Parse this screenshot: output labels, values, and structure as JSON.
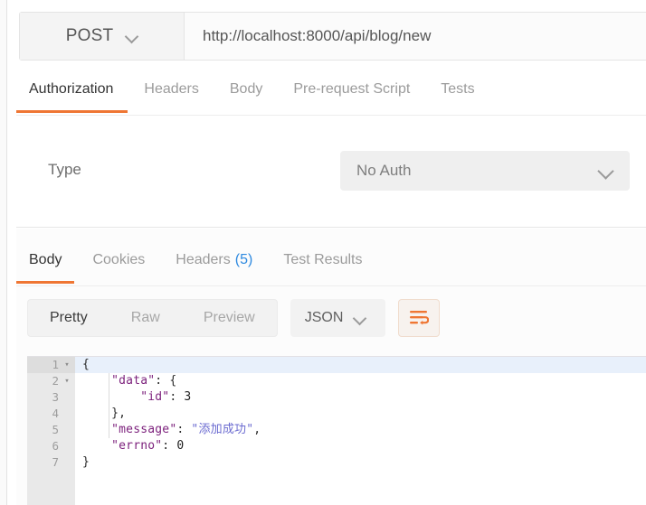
{
  "request": {
    "method": "POST",
    "method_caret_icon": "chevron-down-icon",
    "url": "http://localhost:8000/api/blog/new",
    "url_placeholder": "Enter request URL",
    "tabs": [
      {
        "label": "Authorization",
        "active": true
      },
      {
        "label": "Headers",
        "active": false
      },
      {
        "label": "Body",
        "active": false
      },
      {
        "label": "Pre-request Script",
        "active": false
      },
      {
        "label": "Tests",
        "active": false
      }
    ],
    "auth": {
      "type_label": "Type",
      "type_value": "No Auth",
      "type_caret_icon": "chevron-down-icon"
    }
  },
  "response": {
    "tabs": [
      {
        "label": "Body",
        "count": "",
        "active": true
      },
      {
        "label": "Cookies",
        "count": "",
        "active": false
      },
      {
        "label": "Headers",
        "count": "(5)",
        "active": false
      },
      {
        "label": "Test Results",
        "count": "",
        "active": false
      }
    ],
    "viewer": {
      "modes": [
        {
          "label": "Pretty",
          "active": true
        },
        {
          "label": "Raw",
          "active": false
        },
        {
          "label": "Preview",
          "active": false
        }
      ],
      "format_value": "JSON",
      "format_caret_icon": "chevron-down-icon",
      "wrap_icon": "word-wrap-icon"
    },
    "body": {
      "language": "json",
      "lines": [
        {
          "num": "1",
          "fold": "▾",
          "current": true,
          "tokens": [
            {
              "t": "p",
              "v": "{"
            }
          ]
        },
        {
          "num": "2",
          "fold": "▾",
          "current": false,
          "tokens": [
            {
              "t": "p",
              "v": "    "
            },
            {
              "t": "k",
              "v": "\"data\""
            },
            {
              "t": "p",
              "v": ": {"
            }
          ]
        },
        {
          "num": "3",
          "fold": "",
          "current": false,
          "tokens": [
            {
              "t": "p",
              "v": "        "
            },
            {
              "t": "k",
              "v": "\"id\""
            },
            {
              "t": "p",
              "v": ": "
            },
            {
              "t": "n",
              "v": "3"
            }
          ]
        },
        {
          "num": "4",
          "fold": "",
          "current": false,
          "tokens": [
            {
              "t": "p",
              "v": "    },"
            }
          ]
        },
        {
          "num": "5",
          "fold": "",
          "current": false,
          "tokens": [
            {
              "t": "p",
              "v": "    "
            },
            {
              "t": "k",
              "v": "\"message\""
            },
            {
              "t": "p",
              "v": ": "
            },
            {
              "t": "s",
              "v": "\"添加成功\""
            },
            {
              "t": "p",
              "v": ","
            }
          ]
        },
        {
          "num": "6",
          "fold": "",
          "current": false,
          "tokens": [
            {
              "t": "p",
              "v": "    "
            },
            {
              "t": "k",
              "v": "\"errno\""
            },
            {
              "t": "p",
              "v": ": "
            },
            {
              "t": "n",
              "v": "0"
            }
          ]
        },
        {
          "num": "7",
          "fold": "",
          "current": false,
          "tokens": [
            {
              "t": "p",
              "v": "}"
            }
          ]
        }
      ]
    }
  },
  "colors": {
    "accent_orange": "#ef7633",
    "link_blue": "#2f8ae0",
    "json_key": "#7b1f7b",
    "json_string": "#6a6ad0",
    "current_line": "#e8f0fb",
    "gutter": "#e9e9e9"
  }
}
